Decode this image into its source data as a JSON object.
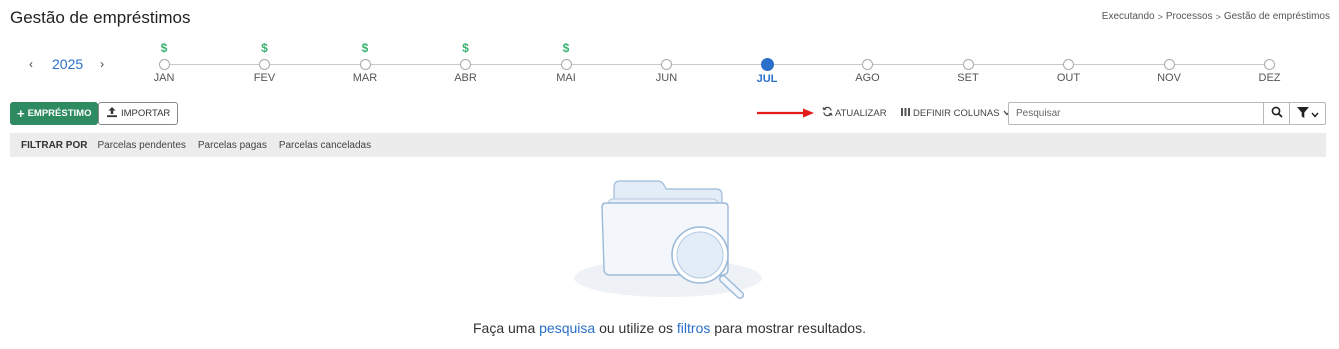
{
  "header": {
    "title": "Gestão de empréstimos",
    "breadcrumb": [
      "Executando",
      "Processos",
      "Gestão de empréstimos"
    ],
    "breadcrumb_sep": ">"
  },
  "year_nav": {
    "prev": "‹",
    "year": "2025",
    "next": "›"
  },
  "timeline": {
    "dollar_symbol": "$",
    "months": [
      {
        "label": "JAN",
        "has_dollar": true,
        "active": false
      },
      {
        "label": "FEV",
        "has_dollar": true,
        "active": false
      },
      {
        "label": "MAR",
        "has_dollar": true,
        "active": false
      },
      {
        "label": "ABR",
        "has_dollar": true,
        "active": false
      },
      {
        "label": "MAI",
        "has_dollar": true,
        "active": false
      },
      {
        "label": "JUN",
        "has_dollar": false,
        "active": false
      },
      {
        "label": "JUL",
        "has_dollar": false,
        "active": true
      },
      {
        "label": "AGO",
        "has_dollar": false,
        "active": false
      },
      {
        "label": "SET",
        "has_dollar": false,
        "active": false
      },
      {
        "label": "OUT",
        "has_dollar": false,
        "active": false
      },
      {
        "label": "NOV",
        "has_dollar": false,
        "active": false
      },
      {
        "label": "DEZ",
        "has_dollar": false,
        "active": false
      }
    ]
  },
  "toolbar": {
    "add_label": "EMPRÉSTIMO",
    "add_plus": "+",
    "import_label": "IMPORTAR",
    "refresh_label": "ATUALIZAR",
    "columns_label": "DEFINIR COLUNAS",
    "search_placeholder": "Pesquisar"
  },
  "filter_bar": {
    "label": "FILTRAR POR",
    "items": [
      "Parcelas pendentes",
      "Parcelas pagas",
      "Parcelas canceladas"
    ]
  },
  "empty_state": {
    "text_1": "Faça uma ",
    "link_1": "pesquisa",
    "text_2": " ou utilize os ",
    "link_2": "filtros",
    "text_3": " para mostrar resultados."
  },
  "colors": {
    "accent_blue": "#2a6fc9",
    "primary_green": "#2e8b61",
    "dollar_green": "#3bb371",
    "annotation_red": "#e31b1b"
  },
  "icons": {
    "refresh": "refresh-icon",
    "columns": "columns-icon",
    "search": "search-icon",
    "filter": "filter-icon",
    "upload": "upload-icon",
    "empty": "folder-search-illustration"
  }
}
